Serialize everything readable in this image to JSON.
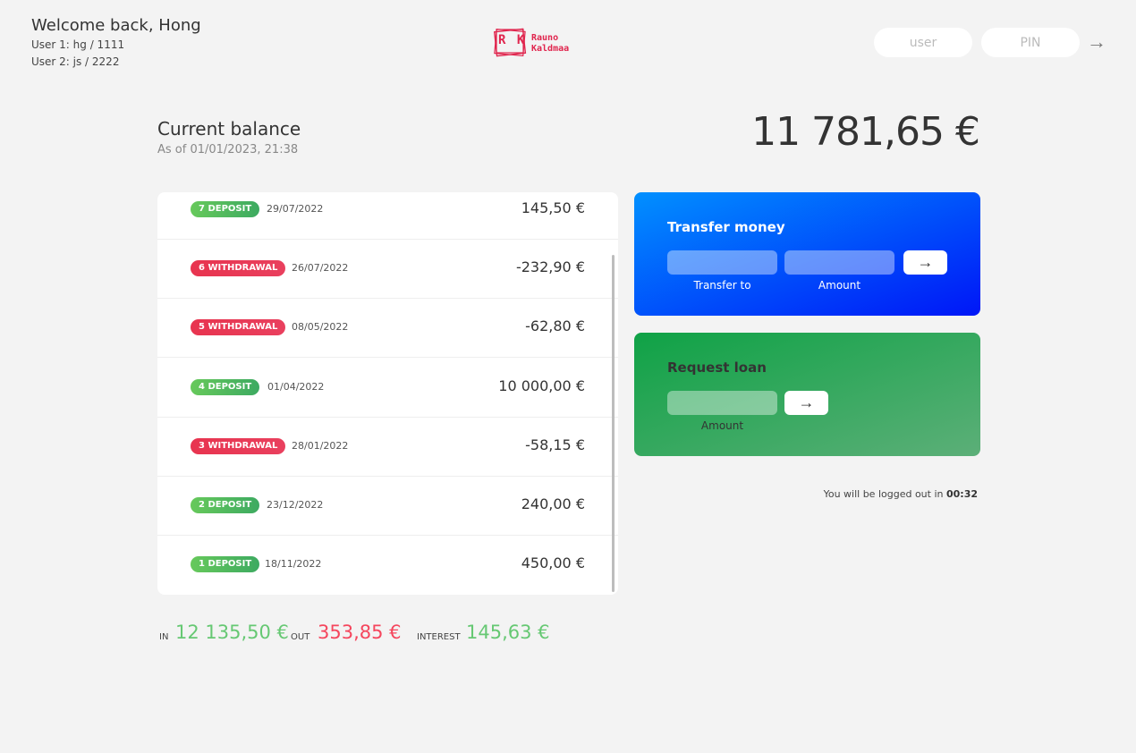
{
  "header": {
    "welcome": "Welcome back, Hong",
    "hint_user1": "User 1: hg / 1111",
    "hint_user2": "User 2: js / 2222",
    "logo_letters": "R K",
    "logo_name": "Rauno\nKaldmaa",
    "login_user_placeholder": "user",
    "login_pin_placeholder": "PIN",
    "login_button": "→"
  },
  "balance": {
    "label": "Current balance",
    "date": "As of 01/01/2023, 21:38",
    "value": "11 781,65 €"
  },
  "movements": [
    {
      "type": "7 deposit",
      "kind": "deposit",
      "date": "29/07/2022",
      "value": "145,50 €"
    },
    {
      "type": "6 withdrawal",
      "kind": "withdrawal",
      "date": "26/07/2022",
      "value": "-232,90 €"
    },
    {
      "type": "5 withdrawal",
      "kind": "withdrawal",
      "date": "08/05/2022",
      "value": "-62,80 €"
    },
    {
      "type": "4 deposit",
      "kind": "deposit",
      "date": "01/04/2022",
      "value": "10 000,00 €"
    },
    {
      "type": "3 withdrawal",
      "kind": "withdrawal",
      "date": "28/01/2022",
      "value": "-58,15 €"
    },
    {
      "type": "2 deposit",
      "kind": "deposit",
      "date": "23/12/2022",
      "value": "240,00 €"
    },
    {
      "type": "1 deposit",
      "kind": "deposit",
      "date": "18/11/2022",
      "value": "450,00 €"
    }
  ],
  "summary": {
    "in_label": "In",
    "in_value": "12 135,50 €",
    "out_label": "Out",
    "out_value": "353,85 €",
    "interest_label": "Interest",
    "interest_value": "145,63 €"
  },
  "transfer": {
    "title": "Transfer money",
    "to_label": "Transfer to",
    "amount_label": "Amount",
    "button": "→"
  },
  "loan": {
    "title": "Request loan",
    "amount_label": "Amount",
    "button": "→"
  },
  "logout": {
    "text": "You will be logged out in ",
    "timer": "00:32"
  },
  "colors": {
    "deposit": "#66c873",
    "withdrawal": "#f5465d",
    "transfer_bg": "#0a3cff",
    "loan_bg": "#2fa757",
    "logo": "#e0264e"
  }
}
